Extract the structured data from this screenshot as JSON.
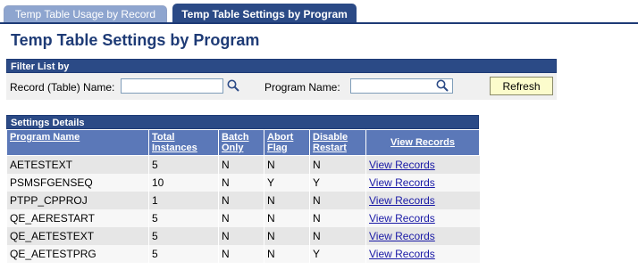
{
  "tabs": [
    {
      "label": "Temp Table Usage by Record",
      "active": false
    },
    {
      "label": "Temp Table Settings by Program",
      "active": true
    }
  ],
  "page_title": "Temp Table Settings by Program",
  "filter": {
    "header": "Filter List by",
    "record_label": "Record (Table) Name:",
    "record_value": "",
    "program_label": "Program Name:",
    "program_value": "",
    "refresh_label": "Refresh"
  },
  "settings": {
    "header": "Settings Details",
    "columns": [
      "Program Name",
      "Total Instances",
      "Batch Only",
      "Abort Flag",
      "Disable Restart",
      "View Records"
    ],
    "rows": [
      {
        "program": "AETESTEXT",
        "instances": "5",
        "batch": "N",
        "abort": "N",
        "disable": "N",
        "link": "View Records"
      },
      {
        "program": "PSMSFGENSEQ",
        "instances": "10",
        "batch": "N",
        "abort": "Y",
        "disable": "Y",
        "link": "View Records"
      },
      {
        "program": "PTPP_CPPROJ",
        "instances": "1",
        "batch": "N",
        "abort": "N",
        "disable": "N",
        "link": "View Records"
      },
      {
        "program": "QE_AERESTART",
        "instances": "5",
        "batch": "N",
        "abort": "N",
        "disable": "N",
        "link": "View Records"
      },
      {
        "program": "QE_AETESTEXT",
        "instances": "5",
        "batch": "N",
        "abort": "N",
        "disable": "N",
        "link": "View Records"
      },
      {
        "program": "QE_AETESTPRG",
        "instances": "5",
        "batch": "N",
        "abort": "N",
        "disable": "Y",
        "link": "View Records"
      }
    ]
  },
  "colors": {
    "header_bg": "#2b4a86",
    "column_header_bg": "#5b78b8",
    "refresh_bg": "#fcfccc",
    "link": "#1a1aa6"
  }
}
